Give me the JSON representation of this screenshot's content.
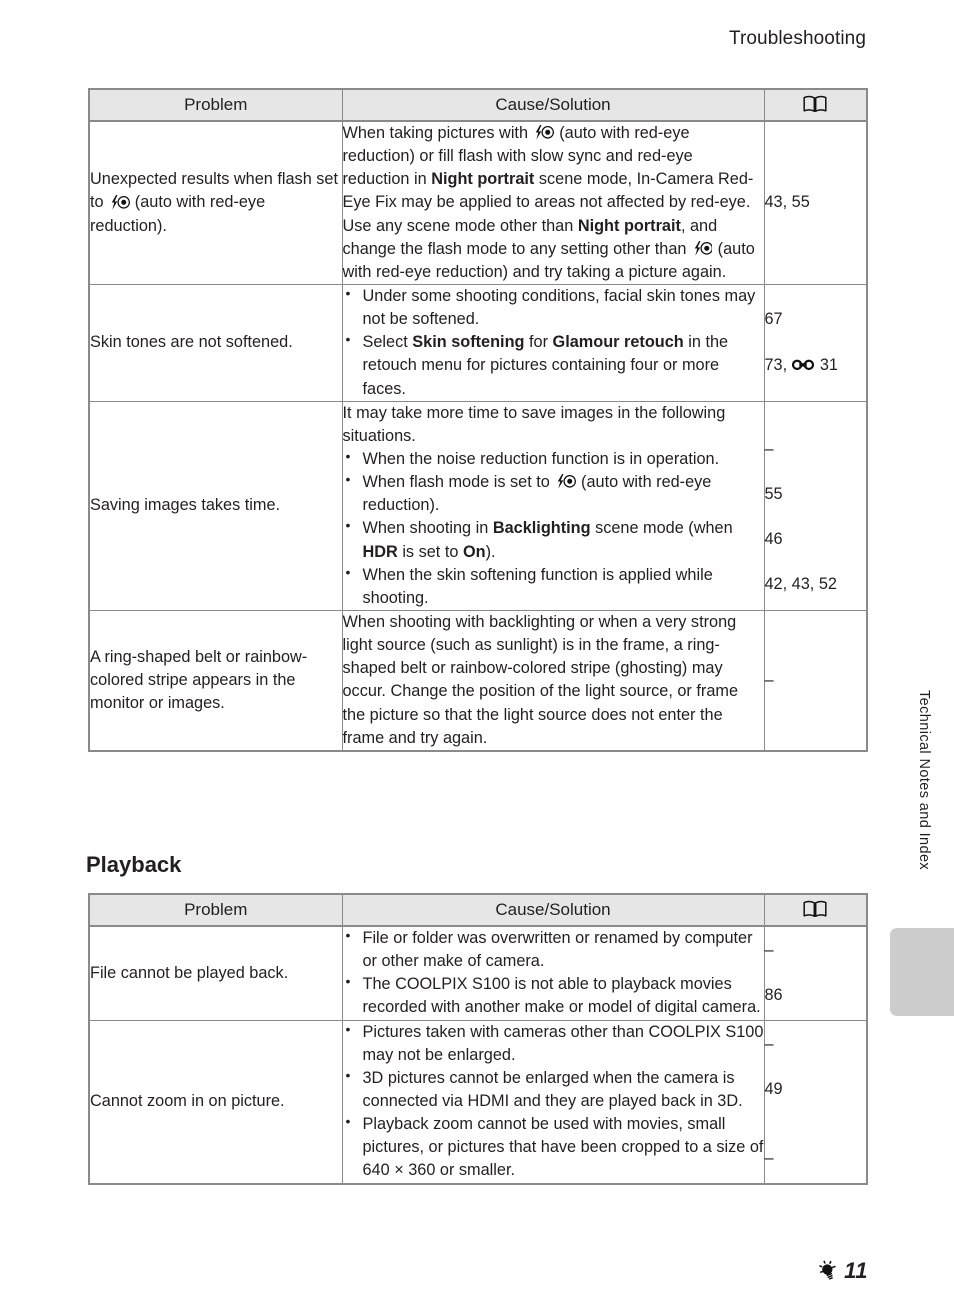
{
  "running_header": "Troubleshooting",
  "side_tab": {
    "label": "Technical Notes and Index"
  },
  "footer": {
    "icon": "bulb-icon",
    "page_number": "11"
  },
  "section": {
    "heading": "Playback"
  },
  "table_headers": {
    "problem": "Problem",
    "cause_solution": "Cause/Solution",
    "reference": "book-icon"
  },
  "shooting_table": {
    "rows": [
      {
        "problem_a": "Unexpected results when",
        "problem_b": "flash set to",
        "problem_c": "(auto with",
        "problem_d": "red-eye reduction).",
        "cause": {
          "p1": "When taking pictures with",
          "p2": "(auto with red-eye reduction) or fill flash with slow sync and red-eye reduction in",
          "bold1": "Night portrait",
          "p3": "scene mode, In-Camera Red-Eye Fix may be applied to areas not affected by red-eye. Use any scene mode other than",
          "bold2": "Night portrait",
          "p4": ", and change the flash mode to any setting other than",
          "p5": "(auto with red-eye reduction) and try taking a picture again."
        },
        "refs": [
          "43, 55"
        ]
      },
      {
        "problem": "Skin tones are not softened.",
        "bullets": [
          {
            "text": "Under some shooting conditions, facial skin tones may not be softened."
          },
          {
            "pre": "Select",
            "bold1": "Skin softening",
            "mid": "for",
            "bold2": "Glamour retouch",
            "post": "in the retouch menu for pictures containing four or more faces."
          }
        ],
        "refs": [
          "67",
          "73,",
          "31"
        ]
      },
      {
        "problem": "Saving images takes time.",
        "lead": "It may take more time to save images in the following situations.",
        "bullets": [
          {
            "text": "When the noise reduction function is in operation."
          },
          {
            "pre": "When flash mode is set to",
            "post": "(auto with red-eye reduction)."
          },
          {
            "pre": "When shooting in",
            "bold1": "Backlighting",
            "mid": "scene mode (when",
            "bold2": "HDR",
            "mid2": "is set to",
            "bold3": "On",
            "post": ")."
          },
          {
            "text": "When the skin softening function is applied while shooting."
          }
        ],
        "refs": [
          "–",
          "55",
          "46",
          "42, 43, 52"
        ]
      },
      {
        "problem": "A ring-shaped belt or rainbow-colored stripe appears in the monitor or images.",
        "cause_text": "When shooting with backlighting or when a very strong light source (such as sunlight) is in the frame, a ring-shaped belt or rainbow-colored stripe (ghosting) may occur. Change the position of the light source, or frame the picture so that the light source does not enter the frame and try again.",
        "refs": [
          "–"
        ]
      }
    ]
  },
  "playback_table": {
    "rows": [
      {
        "problem": "File cannot be played back.",
        "bullets": [
          {
            "text": "File or folder was overwritten or renamed by computer or other make of camera."
          },
          {
            "text": "The COOLPIX S100 is not able to playback movies recorded with another make or model of digital camera."
          }
        ],
        "refs": [
          "–",
          "86"
        ]
      },
      {
        "problem": "Cannot zoom in on picture.",
        "bullets": [
          {
            "text": "Pictures taken with cameras other than COOLPIX S100 may not be enlarged."
          },
          {
            "text": "3D pictures cannot be enlarged when the camera is connected via HDMI and they are played back in 3D."
          },
          {
            "text": "Playback zoom cannot be used with movies, small pictures, or pictures that have been cropped to a size of 640 × 360 or smaller."
          }
        ],
        "refs": [
          "–",
          "49",
          "–"
        ]
      }
    ]
  },
  "colors": {
    "text": "#231f20",
    "header_fill": "#e6e6e6",
    "border": "#8a8a8a",
    "tab_marker": "#cccccc"
  }
}
